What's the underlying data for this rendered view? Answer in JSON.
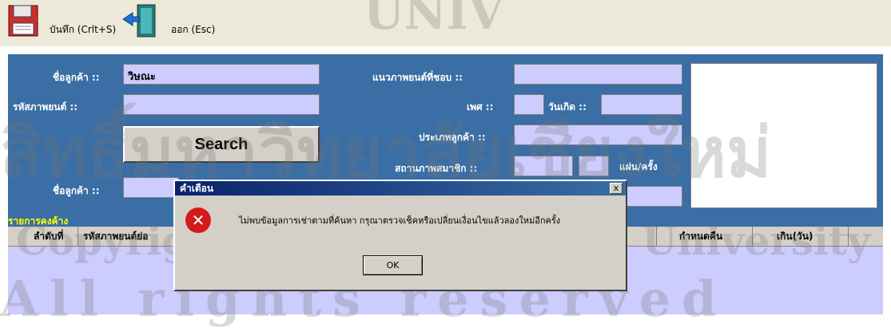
{
  "toolbar": {
    "save_label": "บันทึก (Crlt+S)",
    "exit_label": "ออก (Esc)"
  },
  "form": {
    "customer_name_label": "ชื่อลูกค้า ::",
    "customer_name_value": "วิษณะ",
    "movie_code_label": "รหัสภาพยนต์ ::",
    "movie_code_value": "",
    "search_label": "Search",
    "customer_name2_label": "ชื่อลูกค้า ::",
    "favorite_genre_label": "แนวภาพยนต์ที่ชอบ ::",
    "gender_label": "เพศ ::",
    "birthday_label": "วันเกิด ::",
    "customer_type_label": "ประเภทลูกค้า ::",
    "member_status_label": "สถานภาพสมาชิก ::",
    "discs_per_time_label": "แผ่น/ครั้ง"
  },
  "outstanding": {
    "title": "รายการคงค้าง",
    "columns": [
      "ลำดับที่",
      "รหัสภาพยนต์ย่อ",
      "กำหนดคืน",
      "เกิน(วัน)"
    ]
  },
  "dialog": {
    "title": "คำเตือน",
    "close_label": "x",
    "message": "ไม่พบข้อมูลการเช่าตามที่ค้นหา กรุณาตรวจเช็คหรือเปลี่ยนเงื่อนไขแล้วลองใหม่อีกครั้ง",
    "ok_label": "OK"
  },
  "watermark": {
    "line1": "สิทธิ์มหาวิทยาลัยเชียงใหม่",
    "line2": "Copyright © by Chiang Mai University",
    "line3": "All rights reserved",
    "top": "UNIV"
  },
  "colors": {
    "panel_blue": "#3a6ea5",
    "field_lavender": "#ccccff",
    "dialog_gray": "#d4d0c8",
    "title_text_yellow": "#ffff00"
  },
  "icons": [
    "save-icon",
    "exit-door-icon",
    "error-icon",
    "close-icon"
  ]
}
